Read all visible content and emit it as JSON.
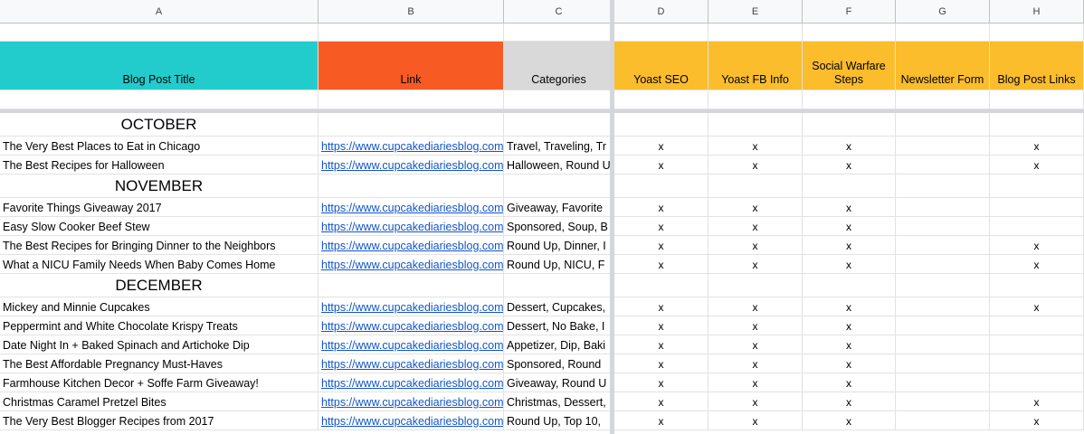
{
  "columns": [
    "A",
    "B",
    "C",
    "D",
    "E",
    "F",
    "G",
    "H"
  ],
  "headers": {
    "title": "Blog Post Title",
    "link": "Link",
    "categories": "Categories",
    "yoast_seo": "Yoast SEO",
    "yoast_fb": "Yoast FB Info",
    "social": "Social Warfare Steps",
    "newsletter": "Newsletter Form",
    "post_links": "Blog Post Links"
  },
  "colors": {
    "title_header": "#22cccc",
    "link_header": "#f85a24",
    "categories_header": "#d9d9d9",
    "yellow_header": "#fbbd2c",
    "link_text": "#1155cc"
  },
  "sections": [
    {
      "month": "OCTOBER",
      "rows": [
        {
          "title": "The Very Best Places to Eat in Chicago",
          "link": "https://www.cupcakediariesblog.com",
          "categories": "Travel, Traveling, Tr",
          "d": "x",
          "e": "x",
          "f": "x",
          "g": "",
          "h": "x"
        },
        {
          "title": "The Best Recipes for Halloween",
          "link": "https://www.cupcakediariesblog.com",
          "categories": "Halloween, Round U",
          "d": "x",
          "e": "x",
          "f": "x",
          "g": "",
          "h": "x"
        }
      ]
    },
    {
      "month": "NOVEMBER",
      "rows": [
        {
          "title": "Favorite Things Giveaway 2017",
          "link": "https://www.cupcakediariesblog.com",
          "categories": "Giveaway, Favorite",
          "d": "x",
          "e": "x",
          "f": "x",
          "g": "",
          "h": ""
        },
        {
          "title": "Easy Slow Cooker Beef Stew",
          "link": "https://www.cupcakediariesblog.com",
          "categories": "Sponsored, Soup, B",
          "d": "x",
          "e": "x",
          "f": "x",
          "g": "",
          "h": ""
        },
        {
          "title": "The Best Recipes for Bringing Dinner to the Neighbors",
          "link": "https://www.cupcakediariesblog.com",
          "categories": "Round Up, Dinner, I",
          "d": "x",
          "e": "x",
          "f": "x",
          "g": "",
          "h": "x"
        },
        {
          "title": "What a NICU Family Needs When Baby Comes Home",
          "link": "https://www.cupcakediariesblog.com",
          "categories": "Round Up, NICU, F",
          "d": "x",
          "e": "x",
          "f": "x",
          "g": "",
          "h": "x"
        }
      ]
    },
    {
      "month": "DECEMBER",
      "rows": [
        {
          "title": "Mickey and Minnie Cupcakes",
          "link": "https://www.cupcakediariesblog.com",
          "categories": "Dessert, Cupcakes,",
          "d": "x",
          "e": "x",
          "f": "x",
          "g": "",
          "h": "x"
        },
        {
          "title": "Peppermint and White Chocolate Krispy Treats",
          "link": "https://www.cupcakediariesblog.com",
          "categories": "Dessert, No Bake, I",
          "d": "x",
          "e": "x",
          "f": "x",
          "g": "",
          "h": ""
        },
        {
          "title": "Date Night In + Baked Spinach and Artichoke Dip",
          "link": "https://www.cupcakediariesblog.com",
          "categories": "Appetizer, Dip, Baki",
          "d": "x",
          "e": "x",
          "f": "x",
          "g": "",
          "h": ""
        },
        {
          "title": "The Best Affordable Pregnancy Must-Haves",
          "link": "https://www.cupcakediariesblog.com",
          "categories": "Sponsored, Round",
          "d": "x",
          "e": "x",
          "f": "x",
          "g": "",
          "h": ""
        },
        {
          "title": "Farmhouse Kitchen Decor + Soffe Farm Giveaway!",
          "link": "https://www.cupcakediariesblog.com",
          "categories": "Giveaway, Round U",
          "d": "x",
          "e": "x",
          "f": "x",
          "g": "",
          "h": ""
        },
        {
          "title": "Christmas Caramel Pretzel Bites",
          "link": "https://www.cupcakediariesblog.com",
          "categories": "Christmas, Dessert,",
          "d": "x",
          "e": "x",
          "f": "x",
          "g": "",
          "h": "x"
        },
        {
          "title": "The Very Best Blogger Recipes from 2017",
          "link": "https://www.cupcakediariesblog.com",
          "categories": "Round Up, Top 10,",
          "d": "x",
          "e": "x",
          "f": "x",
          "g": "",
          "h": "x"
        }
      ]
    }
  ]
}
